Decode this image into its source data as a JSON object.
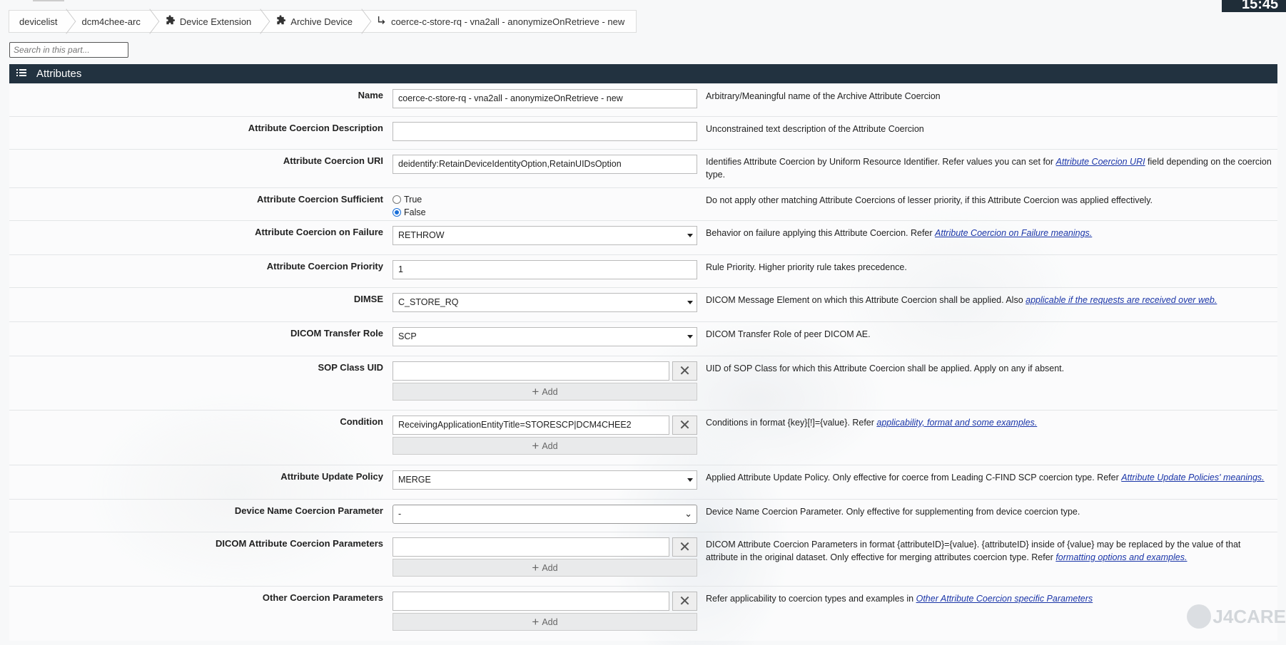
{
  "clock": "15:45",
  "breadcrumb": [
    {
      "label": "devicelist",
      "icon": ""
    },
    {
      "label": "dcm4chee-arc",
      "icon": ""
    },
    {
      "label": "Device Extension",
      "icon": "puzzle-icon"
    },
    {
      "label": "Archive Device",
      "icon": "puzzle-icon"
    },
    {
      "label": "coerce-c-store-rq - vna2all - anonymizeOnRetrieve - new",
      "icon": "child-arrow-icon"
    }
  ],
  "search": {
    "placeholder": "Search in this part..."
  },
  "section": {
    "title": "Attributes",
    "icon": "list-icon"
  },
  "fields": {
    "name": {
      "label": "Name",
      "value": "coerce-c-store-rq - vna2all - anonymizeOnRetrieve - new",
      "desc": "Arbitrary/Meaningful name of the Archive Attribute Coercion"
    },
    "description": {
      "label": "Attribute Coercion Description",
      "value": "",
      "desc": "Unconstrained text description of the Attribute Coercion"
    },
    "uri": {
      "label": "Attribute Coercion URI",
      "value": "deidentify:RetainDeviceIdentityOption,RetainUIDsOption",
      "desc_before": "Identifies Attribute Coercion by Uniform Resource Identifier. Refer values you can set for ",
      "link": "Attribute Coercion URI",
      "desc_after": " field depending on the coercion type."
    },
    "sufficient": {
      "label": "Attribute Coercion Sufficient",
      "options": [
        "True",
        "False"
      ],
      "selected": "False",
      "desc": "Do not apply other matching Attribute Coercions of lesser priority, if this Attribute Coercion was applied effectively."
    },
    "on_failure": {
      "label": "Attribute Coercion on Failure",
      "value": "RETHROW",
      "desc_before": "Behavior on failure applying this Attribute Coercion. Refer ",
      "link": "Attribute Coercion on Failure meanings."
    },
    "priority": {
      "label": "Attribute Coercion Priority",
      "value": "1",
      "desc": "Rule Priority. Higher priority rule takes precedence."
    },
    "dimse": {
      "label": "DIMSE",
      "value": "C_STORE_RQ",
      "desc_before": "DICOM Message Element on which this Attribute Coercion shall be applied. Also ",
      "link": "applicable if the requests are received over web."
    },
    "transfer_role": {
      "label": "DICOM Transfer Role",
      "value": "SCP",
      "desc": "DICOM Transfer Role of peer DICOM AE."
    },
    "sop_class": {
      "label": "SOP Class UID",
      "value": "",
      "add_label": "Add",
      "desc": "UID of SOP Class for which this Attribute Coercion shall be applied. Apply on any if absent."
    },
    "condition": {
      "label": "Condition",
      "value": "ReceivingApplicationEntityTitle=STORESCP|DCM4CHEE2",
      "add_label": "Add",
      "desc_before": "Conditions in format {key}[!]={value}. Refer ",
      "link": "applicability, format and some examples."
    },
    "update_policy": {
      "label": "Attribute Update Policy",
      "value": "MERGE",
      "desc_before": "Applied Attribute Update Policy. Only effective for coerce from Leading C-FIND SCP coercion type. Refer ",
      "link": "Attribute Update Policies' meanings."
    },
    "device_name_param": {
      "label": "Device Name Coercion Parameter",
      "value": "-",
      "desc": "Device Name Coercion Parameter. Only effective for supplementing from device coercion type."
    },
    "dicom_attr_params": {
      "label": "DICOM Attribute Coercion Parameters",
      "value": "",
      "add_label": "Add",
      "desc_before": "DICOM Attribute Coercion Parameters in format {attributeID}={value}. {attributeID} inside of {value} may be replaced by the value of that attribute in the original dataset. Only effective for merging attributes coercion type. Refer ",
      "link": "formatting options and examples."
    },
    "other_params": {
      "label": "Other Coercion Parameters",
      "value": "",
      "add_label": "Add",
      "desc_before": "Refer applicability to coercion types and examples in ",
      "link": "Other Attribute Coercion specific Parameters"
    }
  },
  "logo": "J4CARE"
}
